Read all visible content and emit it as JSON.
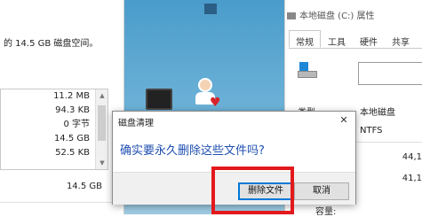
{
  "left_window": {
    "description": "的 14.5 GB 磁盘空间。",
    "file_sizes": [
      "11.2 MB",
      "94.3 KB",
      "0 字节",
      "14.5 GB",
      "52.5 KB"
    ],
    "total": "14.5 GB"
  },
  "properties_window": {
    "title": "本地磁盘 (C:) 属性",
    "tabs": [
      "常规",
      "工具",
      "硬件",
      "共享"
    ],
    "type_label": "类型:",
    "type_value": "本地磁盘",
    "filesystem": "NTFS",
    "used_value": "44,1",
    "free_value": "41,1",
    "capacity_label": "容量:"
  },
  "dialog": {
    "title": "磁盘清理",
    "close_glyph": "✕",
    "message": "确实要永久删除这些文件吗?",
    "delete_label": "删除文件",
    "cancel_label": "取消"
  },
  "colors": {
    "dialog_message": "#1f4fb0",
    "highlight": "#e3191c",
    "primary_button_border": "#0078d7"
  }
}
